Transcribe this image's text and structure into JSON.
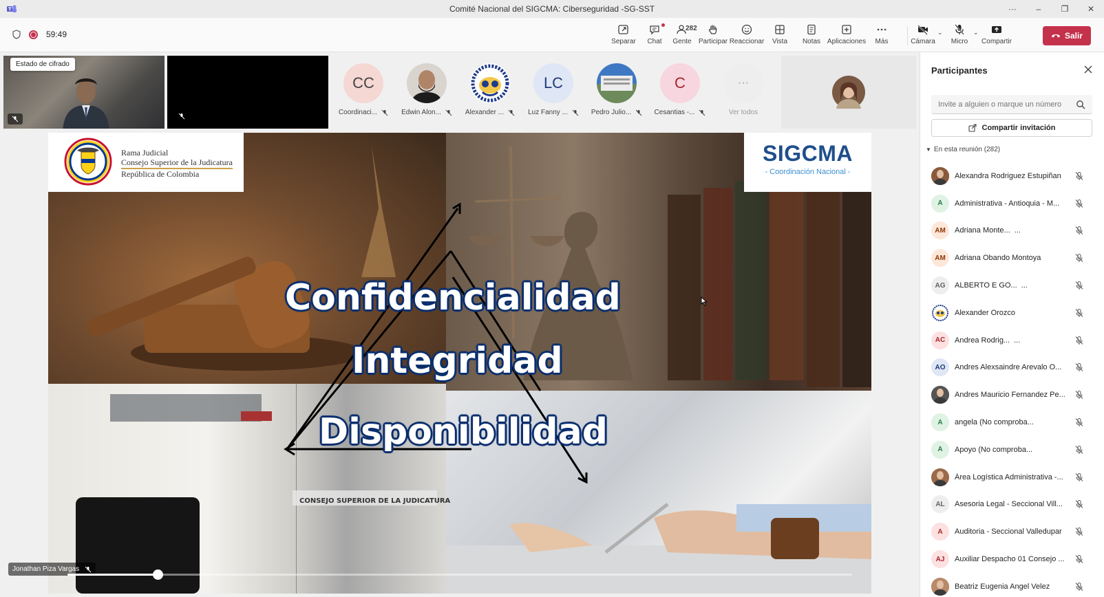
{
  "window": {
    "title": "Comité Nacional del SIGCMA: Ciberseguridad -SG-SST",
    "controls": [
      "···",
      "–",
      "❐",
      "✕"
    ]
  },
  "toolbar": {
    "timer": "59:49",
    "buttons": [
      {
        "label": "Separar",
        "icon": "pop-out-icon"
      },
      {
        "label": "Chat",
        "icon": "chat-icon"
      },
      {
        "label": "Gente",
        "icon": "people-icon",
        "count": "282"
      },
      {
        "label": "Participar",
        "icon": "raise-hand-icon"
      },
      {
        "label": "Reaccionar",
        "icon": "emoji-icon"
      },
      {
        "label": "Vista",
        "icon": "grid-icon"
      },
      {
        "label": "Notas",
        "icon": "notes-icon"
      },
      {
        "label": "Aplicaciones",
        "icon": "apps-icon"
      },
      {
        "label": "Más",
        "icon": "more-icon"
      },
      {
        "label": "Cámara",
        "icon": "camera-off-icon"
      },
      {
        "label": "Micro",
        "icon": "mic-off-icon"
      },
      {
        "label": "Compartir",
        "icon": "share-icon"
      }
    ],
    "leave_label": "Salir",
    "colors": {
      "leave": "#c4314b",
      "accent": "#5b5fc7"
    }
  },
  "strip": {
    "encryption_tooltip": "Estado de cifrado",
    "avatars": [
      {
        "initials": "CC",
        "name": "Coordinaci...",
        "bg": "#f5d7d3",
        "fg": "#444"
      },
      {
        "initials": "",
        "name": "Edwin Alon...",
        "bg": "#d9d4ce",
        "fg": "#444"
      },
      {
        "initials": "",
        "name": "Alexander ...",
        "bg": "#e8eef8",
        "fg": "#444"
      },
      {
        "initials": "LC",
        "name": "Luz Fanny ...",
        "bg": "#dfe6f5",
        "fg": "#1f3b7a"
      },
      {
        "initials": "",
        "name": "Pedro Julio...",
        "bg": "#cfd8e2",
        "fg": "#444"
      },
      {
        "initials": "C",
        "name": "Cesantias -...",
        "bg": "#f7d6df",
        "fg": "#a4262c"
      },
      {
        "initials": "···",
        "name": "Ver todos",
        "bg": "#eeeeee",
        "fg": "#999"
      }
    ]
  },
  "slide": {
    "logo_left_lines": [
      "Rama Judicial",
      "Consejo Superior de la Judicatura",
      "República de Colombia"
    ],
    "logo_right_title": "SIGCMA",
    "logo_right_subtitle": "- Coordinación Nacional -",
    "words": [
      "Confidencialidad",
      "Integridad",
      "Disponibilidad"
    ],
    "sign_text": "CONSEJO SUPERIOR DE LA JUDICATURA",
    "presenter": "Jonathan Piza Vargas",
    "progress": 0.115
  },
  "panel": {
    "title": "Participantes",
    "invite_placeholder": "Invite a alguien o marque un número",
    "share_invite_label": "Compartir invitación",
    "in_meeting_label": "En esta reunión (282)",
    "participants": [
      {
        "initials": "",
        "name": "Alexandra Rodriguez Estupiñan",
        "bg": "#8a5a3c",
        "fg": "#fff"
      },
      {
        "initials": "A",
        "name": "Administrativa - Antioquia - M...",
        "bg": "#e0f2e3",
        "fg": "#237b4b"
      },
      {
        "initials": "AM",
        "name": "Adriana Monte...",
        "bg": "#fde7d9",
        "fg": "#8a3707",
        "suffix": "..."
      },
      {
        "initials": "AM",
        "name": "Adriana Obando Montoya",
        "bg": "#fde7d9",
        "fg": "#8a3707"
      },
      {
        "initials": "AG",
        "name": "ALBERTO E GO...",
        "bg": "#eeeeee",
        "fg": "#616161",
        "suffix": "..."
      },
      {
        "initials": "",
        "name": "Alexander Orozco",
        "bg": "#e8eef8",
        "fg": "#1f3b7a"
      },
      {
        "initials": "AC",
        "name": "Andrea Rodrig...",
        "bg": "#fde0e0",
        "fg": "#a4262c",
        "suffix": "..."
      },
      {
        "initials": "AO",
        "name": "Andres Alexsaindre Arevalo O...",
        "bg": "#dfe6f5",
        "fg": "#1f3b7a"
      },
      {
        "initials": "",
        "name": "Andres Mauricio Fernandez Pe...",
        "bg": "#555555",
        "fg": "#fff"
      },
      {
        "initials": "A",
        "name": "angela (No comproba...",
        "bg": "#e0f2e3",
        "fg": "#237b4b"
      },
      {
        "initials": "A",
        "name": "Apoyo (No comproba...",
        "bg": "#e0f2e3",
        "fg": "#237b4b"
      },
      {
        "initials": "",
        "name": "Área Logística Administrativa -...",
        "bg": "#9a6a4a",
        "fg": "#fff"
      },
      {
        "initials": "AL",
        "name": "Asesoria Legal - Seccional Vill...",
        "bg": "#eeeeee",
        "fg": "#616161"
      },
      {
        "initials": "A",
        "name": "Auditoria - Seccional Valledupar",
        "bg": "#fde0e0",
        "fg": "#a4262c"
      },
      {
        "initials": "AJ",
        "name": "Auxiliar Despacho 01 Consejo ...",
        "bg": "#fde0e0",
        "fg": "#a4262c"
      },
      {
        "initials": "",
        "name": "Beatriz Eugenia Angel Velez",
        "bg": "#b88a6a",
        "fg": "#fff"
      }
    ]
  }
}
